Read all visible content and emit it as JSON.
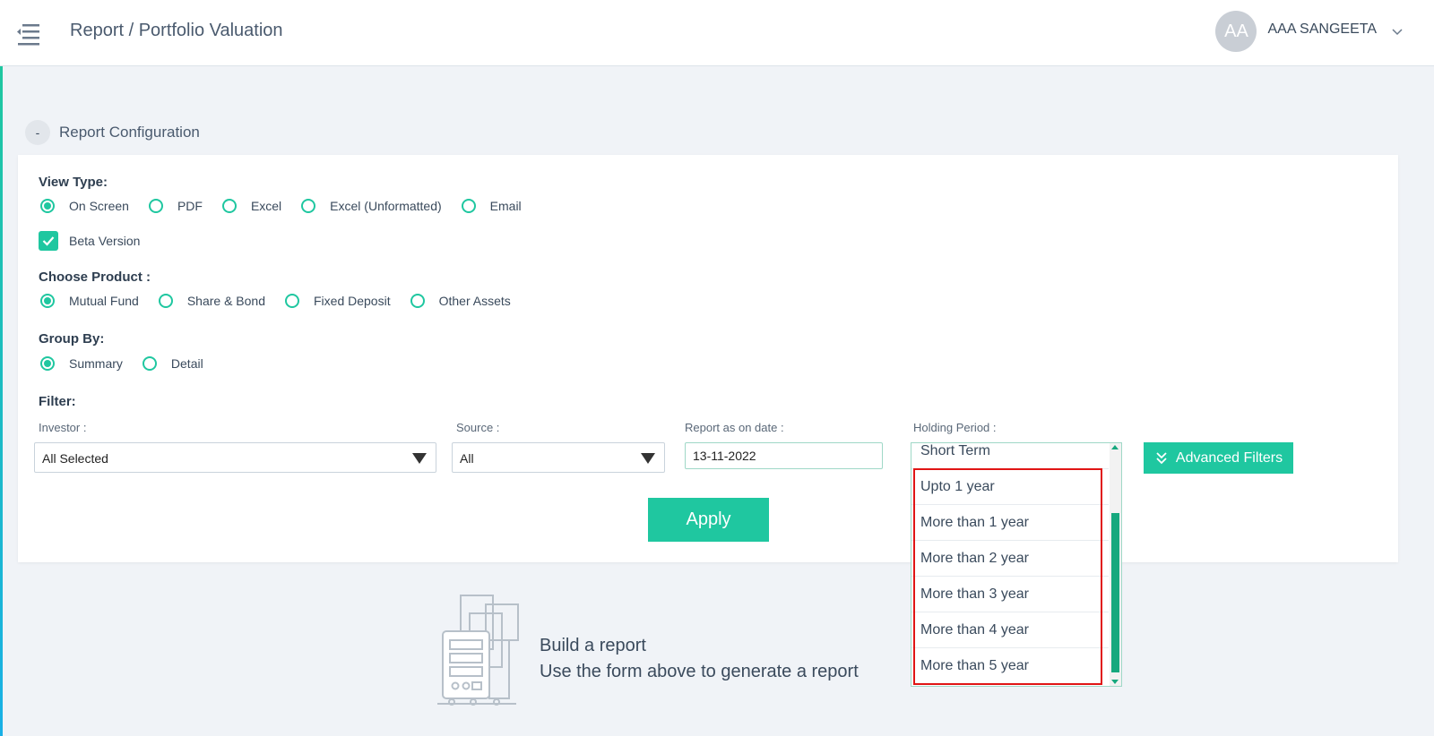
{
  "header": {
    "breadcrumb": "Report / Portfolio Valuation",
    "user_initials": "AA",
    "user_name": "AAA SANGEETA"
  },
  "section": {
    "toggle": "-",
    "title": "Report Configuration"
  },
  "view_type": {
    "label": "View Type:",
    "options": [
      "On Screen",
      "PDF",
      "Excel",
      "Excel (Unformatted)",
      "Email"
    ],
    "selected": "On Screen"
  },
  "beta": {
    "label": "Beta Version",
    "checked": true
  },
  "product": {
    "label": "Choose Product :",
    "options": [
      "Mutual Fund",
      "Share & Bond",
      "Fixed Deposit",
      "Other Assets"
    ],
    "selected": "Mutual Fund"
  },
  "group_by": {
    "label": "Group By:",
    "options": [
      "Summary",
      "Detail"
    ],
    "selected": "Summary"
  },
  "filter": {
    "label": "Filter:",
    "investor_label": "Investor :",
    "investor_value": "All Selected",
    "source_label": "Source :",
    "source_value": "All",
    "date_label": "Report as on date :",
    "date_value": "13-11-2022",
    "holding_label": "Holding Period :",
    "holding_options": [
      "Short Term",
      "Upto 1 year",
      "More than 1 year",
      "More than 2 year",
      "More than 3 year",
      "More than 4 year",
      "More than 5 year"
    ],
    "advanced_label": "Advanced Filters"
  },
  "apply_label": "Apply",
  "empty_state": {
    "title": "Build a report",
    "subtitle": "Use the form above to generate a report"
  },
  "colors": {
    "accent": "#1fc7a0",
    "highlight": "#e01515",
    "scrollbar": "#16a87e"
  }
}
